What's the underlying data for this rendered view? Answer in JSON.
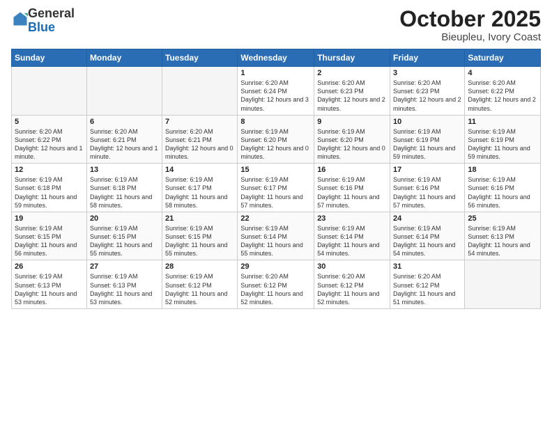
{
  "header": {
    "logo_general": "General",
    "logo_blue": "Blue",
    "title": "October 2025",
    "subtitle": "Bieupleu, Ivory Coast"
  },
  "calendar": {
    "days_of_week": [
      "Sunday",
      "Monday",
      "Tuesday",
      "Wednesday",
      "Thursday",
      "Friday",
      "Saturday"
    ],
    "weeks": [
      [
        {
          "day": "",
          "info": ""
        },
        {
          "day": "",
          "info": ""
        },
        {
          "day": "",
          "info": ""
        },
        {
          "day": "1",
          "info": "Sunrise: 6:20 AM\nSunset: 6:24 PM\nDaylight: 12 hours and 3 minutes."
        },
        {
          "day": "2",
          "info": "Sunrise: 6:20 AM\nSunset: 6:23 PM\nDaylight: 12 hours and 2 minutes."
        },
        {
          "day": "3",
          "info": "Sunrise: 6:20 AM\nSunset: 6:23 PM\nDaylight: 12 hours and 2 minutes."
        },
        {
          "day": "4",
          "info": "Sunrise: 6:20 AM\nSunset: 6:22 PM\nDaylight: 12 hours and 2 minutes."
        }
      ],
      [
        {
          "day": "5",
          "info": "Sunrise: 6:20 AM\nSunset: 6:22 PM\nDaylight: 12 hours and 1 minute."
        },
        {
          "day": "6",
          "info": "Sunrise: 6:20 AM\nSunset: 6:21 PM\nDaylight: 12 hours and 1 minute."
        },
        {
          "day": "7",
          "info": "Sunrise: 6:20 AM\nSunset: 6:21 PM\nDaylight: 12 hours and 0 minutes."
        },
        {
          "day": "8",
          "info": "Sunrise: 6:19 AM\nSunset: 6:20 PM\nDaylight: 12 hours and 0 minutes."
        },
        {
          "day": "9",
          "info": "Sunrise: 6:19 AM\nSunset: 6:20 PM\nDaylight: 12 hours and 0 minutes."
        },
        {
          "day": "10",
          "info": "Sunrise: 6:19 AM\nSunset: 6:19 PM\nDaylight: 11 hours and 59 minutes."
        },
        {
          "day": "11",
          "info": "Sunrise: 6:19 AM\nSunset: 6:19 PM\nDaylight: 11 hours and 59 minutes."
        }
      ],
      [
        {
          "day": "12",
          "info": "Sunrise: 6:19 AM\nSunset: 6:18 PM\nDaylight: 11 hours and 59 minutes."
        },
        {
          "day": "13",
          "info": "Sunrise: 6:19 AM\nSunset: 6:18 PM\nDaylight: 11 hours and 58 minutes."
        },
        {
          "day": "14",
          "info": "Sunrise: 6:19 AM\nSunset: 6:17 PM\nDaylight: 11 hours and 58 minutes."
        },
        {
          "day": "15",
          "info": "Sunrise: 6:19 AM\nSunset: 6:17 PM\nDaylight: 11 hours and 57 minutes."
        },
        {
          "day": "16",
          "info": "Sunrise: 6:19 AM\nSunset: 6:16 PM\nDaylight: 11 hours and 57 minutes."
        },
        {
          "day": "17",
          "info": "Sunrise: 6:19 AM\nSunset: 6:16 PM\nDaylight: 11 hours and 57 minutes."
        },
        {
          "day": "18",
          "info": "Sunrise: 6:19 AM\nSunset: 6:16 PM\nDaylight: 11 hours and 56 minutes."
        }
      ],
      [
        {
          "day": "19",
          "info": "Sunrise: 6:19 AM\nSunset: 6:15 PM\nDaylight: 11 hours and 56 minutes."
        },
        {
          "day": "20",
          "info": "Sunrise: 6:19 AM\nSunset: 6:15 PM\nDaylight: 11 hours and 55 minutes."
        },
        {
          "day": "21",
          "info": "Sunrise: 6:19 AM\nSunset: 6:15 PM\nDaylight: 11 hours and 55 minutes."
        },
        {
          "day": "22",
          "info": "Sunrise: 6:19 AM\nSunset: 6:14 PM\nDaylight: 11 hours and 55 minutes."
        },
        {
          "day": "23",
          "info": "Sunrise: 6:19 AM\nSunset: 6:14 PM\nDaylight: 11 hours and 54 minutes."
        },
        {
          "day": "24",
          "info": "Sunrise: 6:19 AM\nSunset: 6:14 PM\nDaylight: 11 hours and 54 minutes."
        },
        {
          "day": "25",
          "info": "Sunrise: 6:19 AM\nSunset: 6:13 PM\nDaylight: 11 hours and 54 minutes."
        }
      ],
      [
        {
          "day": "26",
          "info": "Sunrise: 6:19 AM\nSunset: 6:13 PM\nDaylight: 11 hours and 53 minutes."
        },
        {
          "day": "27",
          "info": "Sunrise: 6:19 AM\nSunset: 6:13 PM\nDaylight: 11 hours and 53 minutes."
        },
        {
          "day": "28",
          "info": "Sunrise: 6:19 AM\nSunset: 6:12 PM\nDaylight: 11 hours and 52 minutes."
        },
        {
          "day": "29",
          "info": "Sunrise: 6:20 AM\nSunset: 6:12 PM\nDaylight: 11 hours and 52 minutes."
        },
        {
          "day": "30",
          "info": "Sunrise: 6:20 AM\nSunset: 6:12 PM\nDaylight: 11 hours and 52 minutes."
        },
        {
          "day": "31",
          "info": "Sunrise: 6:20 AM\nSunset: 6:12 PM\nDaylight: 11 hours and 51 minutes."
        },
        {
          "day": "",
          "info": ""
        }
      ]
    ]
  }
}
